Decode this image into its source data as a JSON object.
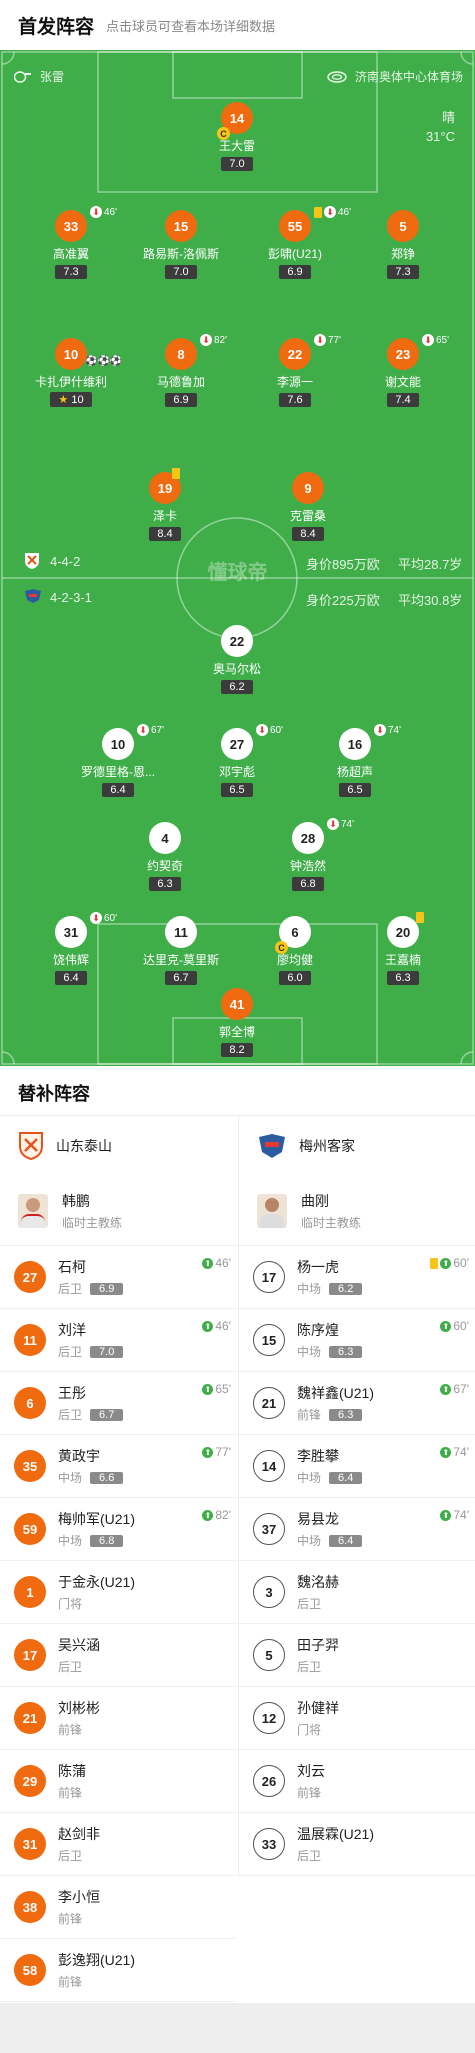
{
  "header": {
    "title": "首发阵容",
    "hint": "点击球员可查看本场详细数据"
  },
  "pitch": {
    "referee": "张雷",
    "venue": "济南奥体中心体育场",
    "weather": "晴",
    "temperature": "31°C",
    "watermark": "懂球帝",
    "home_team_line": {
      "formation": "4-4-2",
      "value": "身价895万欧",
      "avg_age": "平均28.7岁"
    },
    "away_team_line": {
      "formation": "4-2-3-1",
      "value": "身价225万欧",
      "avg_age": "平均30.8岁"
    }
  },
  "home_players": [
    {
      "num": "14",
      "name": "王大雷",
      "rating": "7.0",
      "captain": true
    },
    {
      "num": "33",
      "name": "高准翼",
      "rating": "7.3",
      "sub": "46'"
    },
    {
      "num": "15",
      "name": "路易斯-洛佩斯",
      "rating": "7.0"
    },
    {
      "num": "55",
      "name": "彭啸(U21)",
      "rating": "6.9",
      "sub": "46'",
      "yellow": true
    },
    {
      "num": "5",
      "name": "郑铮",
      "rating": "7.3"
    },
    {
      "num": "10",
      "name": "卡扎伊什维利",
      "rating": "10",
      "goals": "⚽⚽⚽",
      "star": true
    },
    {
      "num": "8",
      "name": "马德鲁加",
      "rating": "6.9",
      "sub": "82'"
    },
    {
      "num": "22",
      "name": "李源一",
      "rating": "7.6",
      "sub": "77'"
    },
    {
      "num": "23",
      "name": "谢文能",
      "rating": "7.4",
      "sub": "65'"
    },
    {
      "num": "19",
      "name": "泽卡",
      "rating": "8.4",
      "yellow": true
    },
    {
      "num": "9",
      "name": "克雷桑",
      "rating": "8.4"
    }
  ],
  "away_players": [
    {
      "num": "22",
      "name": "奥马尔松",
      "rating": "6.2"
    },
    {
      "num": "10",
      "name": "罗德里格-恩...",
      "rating": "6.4",
      "sub": "67'"
    },
    {
      "num": "27",
      "name": "邓宇彪",
      "rating": "6.5",
      "sub": "60'"
    },
    {
      "num": "16",
      "name": "杨超声",
      "rating": "6.5",
      "sub": "74'"
    },
    {
      "num": "4",
      "name": "约契奇",
      "rating": "6.3"
    },
    {
      "num": "28",
      "name": "钟浩然",
      "rating": "6.8",
      "sub": "74'"
    },
    {
      "num": "31",
      "name": "饶伟辉",
      "rating": "6.4",
      "sub": "60'"
    },
    {
      "num": "11",
      "name": "达里克-莫里斯",
      "rating": "6.7"
    },
    {
      "num": "6",
      "name": "廖均健",
      "rating": "6.0",
      "captain": true
    },
    {
      "num": "20",
      "name": "王嘉楠",
      "rating": "6.3",
      "yellow": true
    },
    {
      "num": "41",
      "name": "郭全博",
      "rating": "8.2"
    }
  ],
  "subs": {
    "title": "替补阵容",
    "home": {
      "team": "山东泰山",
      "coach": {
        "name": "韩鹏",
        "role": "临时主教练"
      },
      "players": [
        {
          "num": "27",
          "name": "石柯",
          "pos": "后卫",
          "rating": "6.9",
          "in": "46'"
        },
        {
          "num": "11",
          "name": "刘洋",
          "pos": "后卫",
          "rating": "7.0",
          "in": "46'"
        },
        {
          "num": "6",
          "name": "王彤",
          "pos": "后卫",
          "rating": "6.7",
          "in": "65'"
        },
        {
          "num": "35",
          "name": "黄政宇",
          "pos": "中场",
          "rating": "6.6",
          "in": "77'"
        },
        {
          "num": "59",
          "name": "梅帅军(U21)",
          "pos": "中场",
          "rating": "6.8",
          "in": "82'"
        },
        {
          "num": "1",
          "name": "于金永(U21)",
          "pos": "门将"
        },
        {
          "num": "17",
          "name": "吴兴涵",
          "pos": "后卫"
        },
        {
          "num": "21",
          "name": "刘彬彬",
          "pos": "前锋"
        },
        {
          "num": "29",
          "name": "陈蒲",
          "pos": "前锋"
        },
        {
          "num": "31",
          "name": "赵剑非",
          "pos": "后卫"
        },
        {
          "num": "38",
          "name": "李小恒",
          "pos": "前锋"
        },
        {
          "num": "58",
          "name": "彭逸翔(U21)",
          "pos": "前锋"
        }
      ]
    },
    "away": {
      "team": "梅州客家",
      "coach": {
        "name": "曲刚",
        "role": "临时主教练"
      },
      "players": [
        {
          "num": "17",
          "name": "杨一虎",
          "pos": "中场",
          "rating": "6.2",
          "in": "60'",
          "yellow": true
        },
        {
          "num": "15",
          "name": "陈序煌",
          "pos": "中场",
          "rating": "6.3",
          "in": "60'"
        },
        {
          "num": "21",
          "name": "魏祥鑫(U21)",
          "pos": "前锋",
          "rating": "6.3",
          "in": "67'"
        },
        {
          "num": "14",
          "name": "李胜攀",
          "pos": "中场",
          "rating": "6.4",
          "in": "74'"
        },
        {
          "num": "37",
          "name": "易县龙",
          "pos": "中场",
          "rating": "6.4",
          "in": "74'"
        },
        {
          "num": "3",
          "name": "魏洺赫",
          "pos": "后卫"
        },
        {
          "num": "5",
          "name": "田子羿",
          "pos": "后卫"
        },
        {
          "num": "12",
          "name": "孙健祥",
          "pos": "门将"
        },
        {
          "num": "26",
          "name": "刘云",
          "pos": "前锋"
        },
        {
          "num": "33",
          "name": "温展霖(U21)",
          "pos": "后卫"
        }
      ]
    }
  }
}
